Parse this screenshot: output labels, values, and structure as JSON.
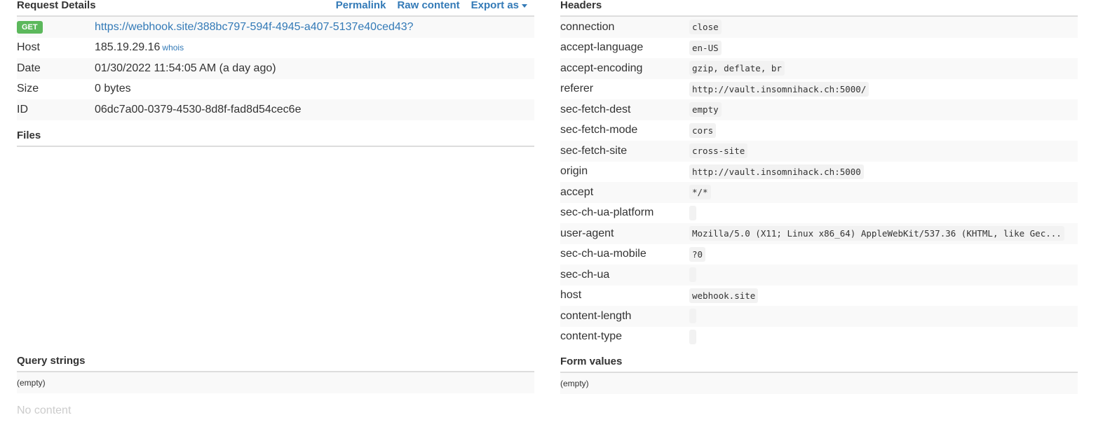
{
  "request": {
    "title": "Request Details",
    "links": {
      "permalink": "Permalink",
      "raw": "Raw content",
      "export": "Export as"
    },
    "method": "GET",
    "url": "https://webhook.site/388bc797-594f-4945-a407-5137e40ced43?",
    "rows": [
      {
        "key": "Host",
        "value": "185.19.29.16",
        "extra": "whois"
      },
      {
        "key": "Date",
        "value": "01/30/2022 11:54:05 AM (a day ago)"
      },
      {
        "key": "Size",
        "value": "0 bytes"
      },
      {
        "key": "ID",
        "value": "06dc7a00-0379-4530-8d8f-fad8d54cec6e"
      }
    ]
  },
  "files": {
    "title": "Files"
  },
  "query": {
    "title": "Query strings",
    "empty": "(empty)",
    "no_content": "No content"
  },
  "headers": {
    "title": "Headers",
    "rows": [
      {
        "key": "connection",
        "value": "close"
      },
      {
        "key": "accept-language",
        "value": "en-US"
      },
      {
        "key": "accept-encoding",
        "value": "gzip, deflate, br"
      },
      {
        "key": "referer",
        "value": "http://vault.insomnihack.ch:5000/"
      },
      {
        "key": "sec-fetch-dest",
        "value": "empty"
      },
      {
        "key": "sec-fetch-mode",
        "value": "cors"
      },
      {
        "key": "sec-fetch-site",
        "value": "cross-site"
      },
      {
        "key": "origin",
        "value": "http://vault.insomnihack.ch:5000"
      },
      {
        "key": "accept",
        "value": "*/*"
      },
      {
        "key": "sec-ch-ua-platform",
        "value": ""
      },
      {
        "key": "user-agent",
        "value": "Mozilla/5.0 (X11; Linux x86_64) AppleWebKit/537.36 (KHTML, like Gec..."
      },
      {
        "key": "sec-ch-ua-mobile",
        "value": "?0"
      },
      {
        "key": "sec-ch-ua",
        "value": ""
      },
      {
        "key": "host",
        "value": "webhook.site"
      },
      {
        "key": "content-length",
        "value": ""
      },
      {
        "key": "content-type",
        "value": ""
      }
    ]
  },
  "form": {
    "title": "Form values",
    "empty": "(empty)"
  }
}
